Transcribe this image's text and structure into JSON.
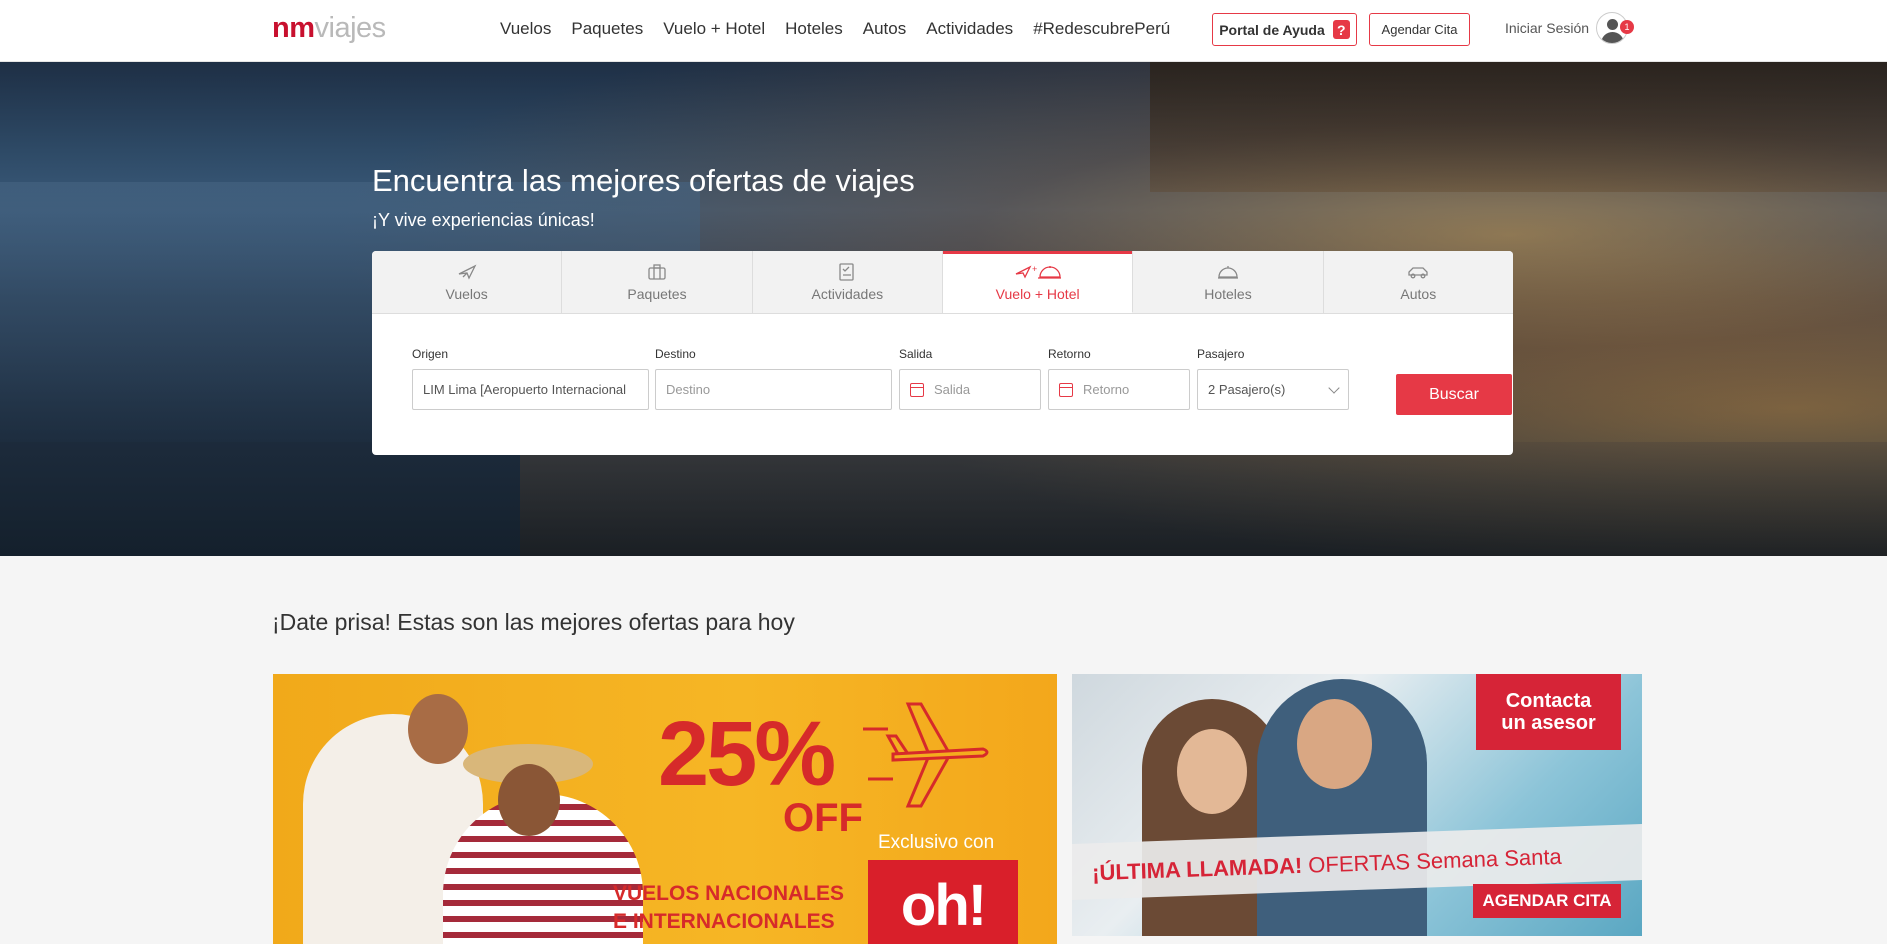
{
  "header": {
    "logo_nm": "nm",
    "logo_viajes": "viajes",
    "nav": [
      "Vuelos",
      "Paquetes",
      "Vuelo + Hotel",
      "Hoteles",
      "Autos",
      "Actividades",
      "#RedescubrePerú"
    ],
    "help_label": "Portal de Ayuda",
    "help_icon": "?",
    "cita_label": "Agendar Cita",
    "login_label": "Iniciar Sesión",
    "notification_count": "1"
  },
  "hero": {
    "title": "Encuentra las mejores ofertas de viajes",
    "subtitle": "¡Y vive experiencias únicas!"
  },
  "search": {
    "tabs": [
      {
        "label": "Vuelos",
        "icon": "plane-icon"
      },
      {
        "label": "Paquetes",
        "icon": "briefcase-icon"
      },
      {
        "label": "Actividades",
        "icon": "activities-icon"
      },
      {
        "label": "Vuelo + Hotel",
        "icon": "plane-hotel-icon",
        "active": true
      },
      {
        "label": "Hoteles",
        "icon": "hotel-bell-icon"
      },
      {
        "label": "Autos",
        "icon": "car-icon"
      }
    ],
    "origen_label": "Origen",
    "origen_value": "LIM Lima [Aeropuerto Internacional",
    "destino_label": "Destino",
    "destino_placeholder": "Destino",
    "salida_label": "Salida",
    "salida_placeholder": "Salida",
    "retorno_label": "Retorno",
    "retorno_placeholder": "Retorno",
    "pasajero_label": "Pasajero",
    "pasajero_value": "2  Pasajero(s)",
    "buscar_label": "Buscar"
  },
  "offers": {
    "title": "¡Date prisa! Estas son las mejores ofertas para hoy",
    "banner_left": {
      "percent": "25%",
      "off": "OFF",
      "line1": "VUELOS NACIONALES",
      "line2": "E INTERNACIONALES",
      "exclusivo": "Exclusivo con",
      "brand": "oh!"
    },
    "banner_right": {
      "contacta_1": "Contacta",
      "contacta_2": "un asesor",
      "ultima_bold": "¡ÚLTIMA LLAMADA!",
      "ultima_rest": " OFERTAS Semana Santa",
      "agendar": "AGENDAR CITA"
    }
  },
  "colors": {
    "accent": "#e63946",
    "brand_red": "#c8102e",
    "banner_yellow": "#f6b625"
  }
}
